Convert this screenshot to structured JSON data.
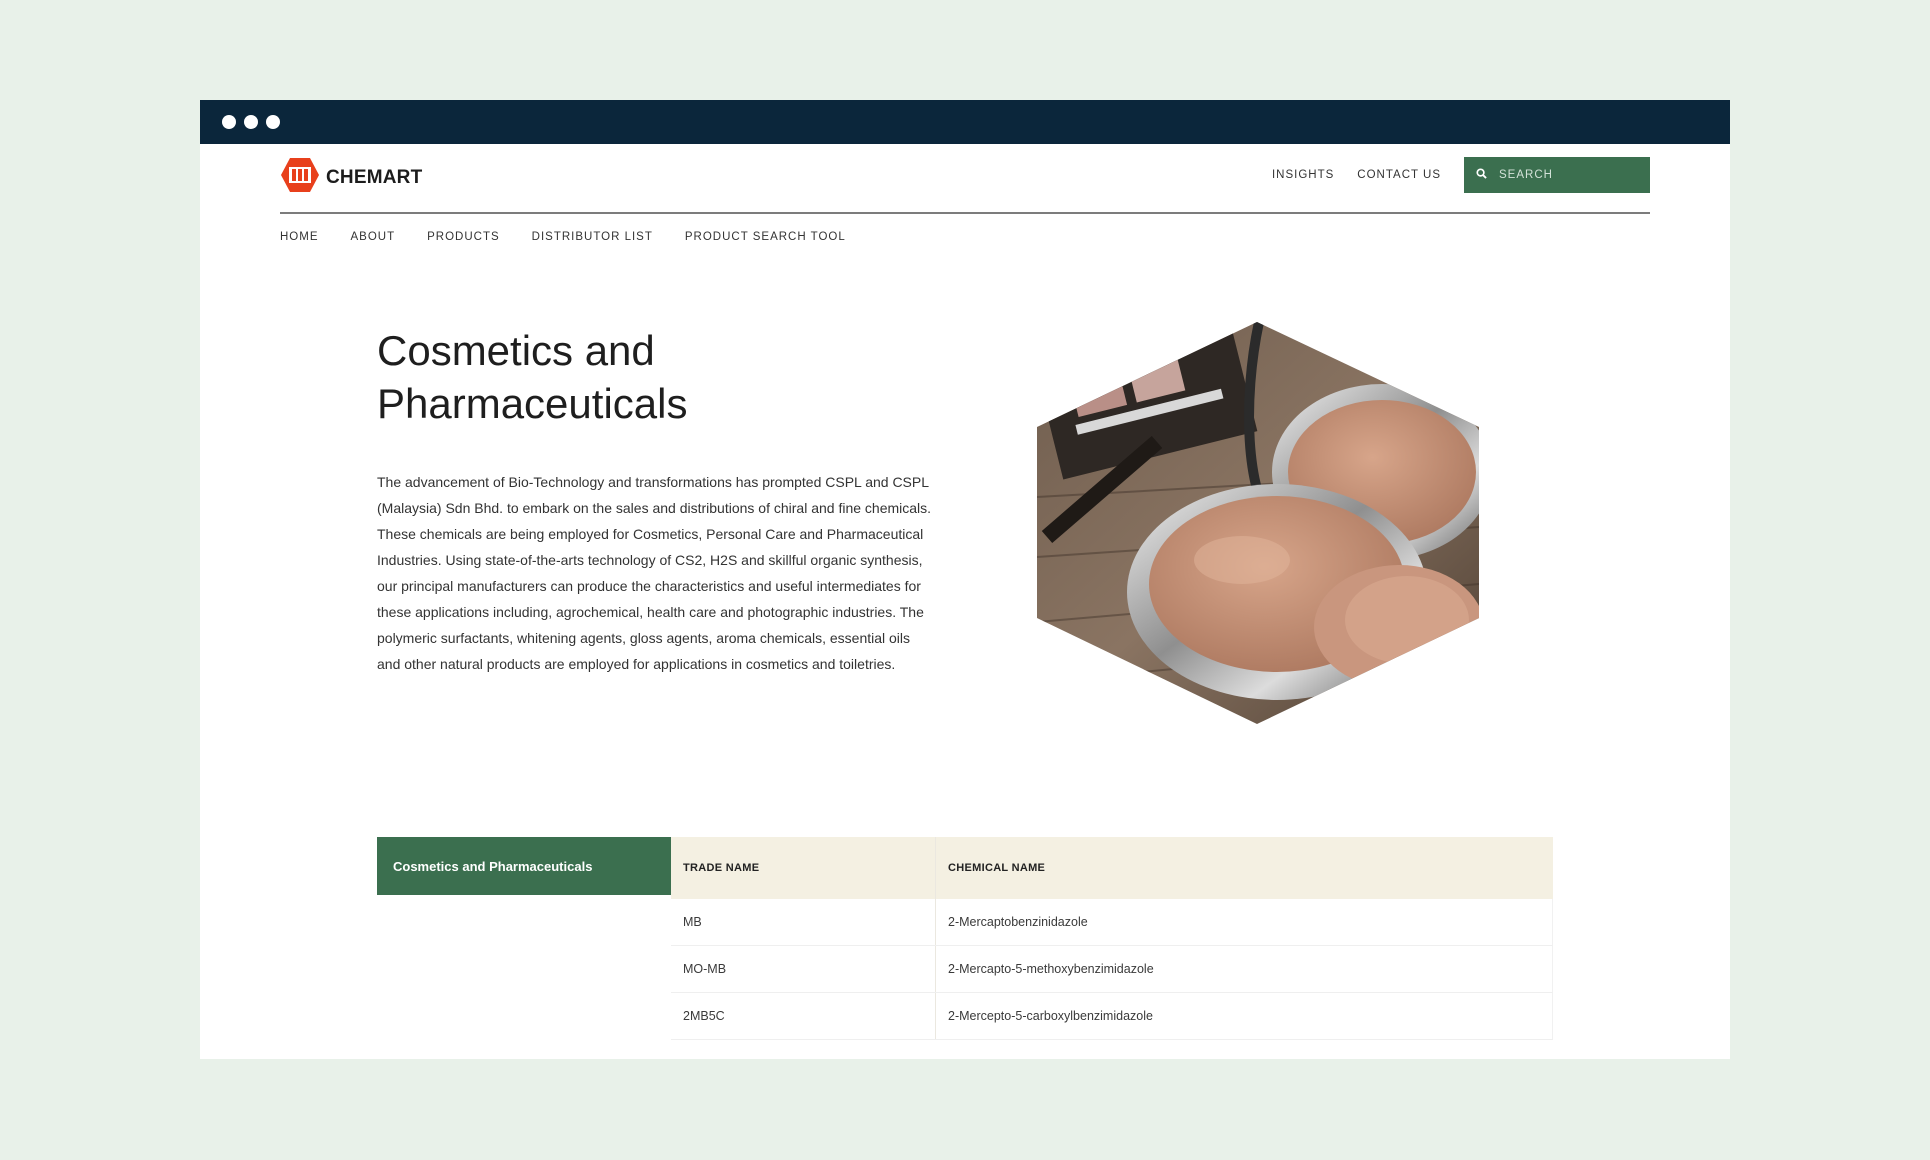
{
  "window": {
    "control_dots": [
      "close",
      "minimize",
      "maximize"
    ]
  },
  "brand": {
    "name": "CHEMART",
    "logo_color": "#e8401c"
  },
  "top_nav": {
    "insights": "INSIGHTS",
    "contact": "CONTACT US"
  },
  "search": {
    "placeholder": "SEARCH"
  },
  "main_nav": {
    "items": [
      "HOME",
      "ABOUT",
      "PRODUCTS",
      "DISTRIBUTOR LIST",
      "PRODUCT SEARCH TOOL"
    ]
  },
  "hero": {
    "title": "Cosmetics and Pharmaceuticals",
    "body": "The advancement of Bio-Technology and transformations has prompted CSPL and CSPL (Malaysia) Sdn Bhd. to embark on the sales and distributions of chiral and fine chemicals. These chemicals are being employed for Cosmetics, Personal Care and Pharmaceutical Industries. Using state-of-the-arts technology of CS2, H2S and skillful organic synthesis, our principal manufacturers can produce the characteristics and useful intermediates for these applications including, agrochemical, health care and photographic industries. The polymeric surfactants, whitening agents, gloss agents, aroma chemicals, essential oils and other natural products are employed for applications in cosmetics and toiletries."
  },
  "category_tab": {
    "label": "Cosmetics and Pharmaceuticals"
  },
  "table": {
    "headers": [
      "TRADE NAME",
      "CHEMICAL NAME"
    ],
    "rows": [
      [
        "MB",
        "2-Mercaptobenzinidazole"
      ],
      [
        "MO-MB",
        "2-Mercapto-5-methoxybenzimidazole"
      ],
      [
        "2MB5C",
        "2-Mercepto-5-carboxylbenzimidazole"
      ]
    ]
  },
  "colors": {
    "titlebar": "#0b263b",
    "accent_green": "#3b6f4f",
    "table_header_bg": "#f4f0e2",
    "page_bg": "#e8f1e9"
  }
}
